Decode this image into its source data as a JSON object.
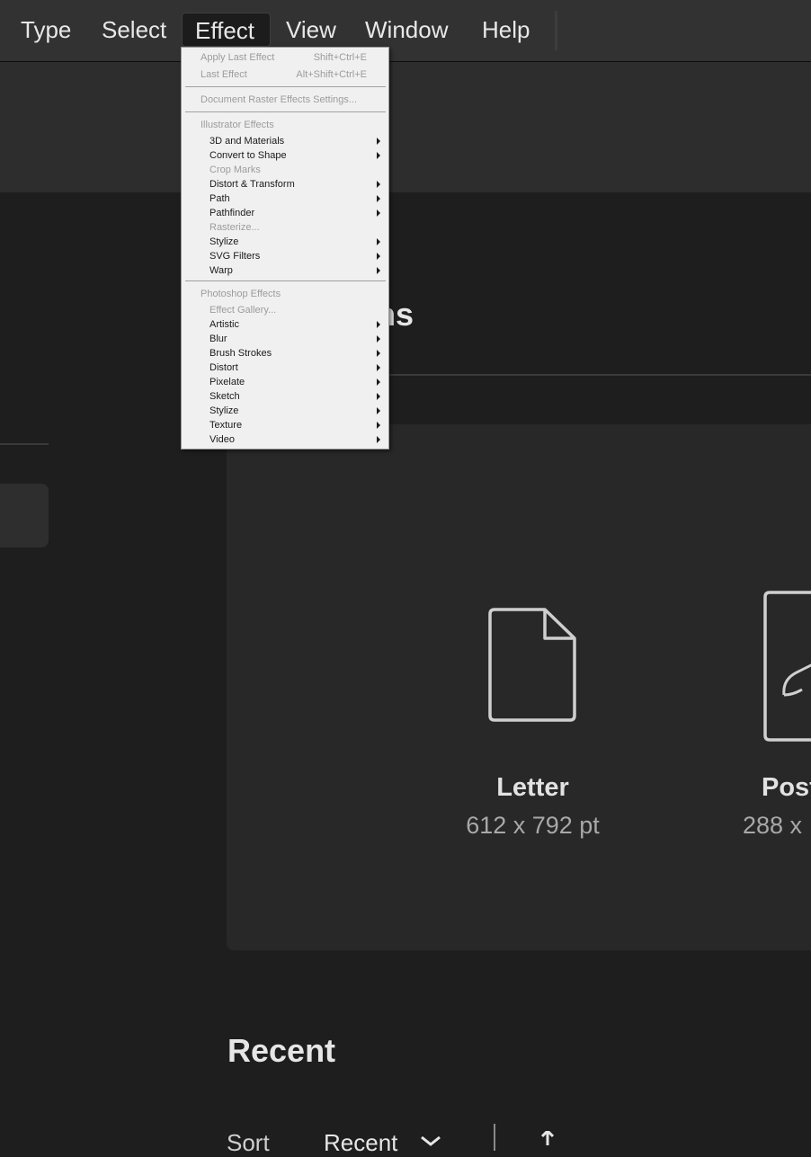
{
  "menubar": {
    "items": [
      {
        "label": "Type"
      },
      {
        "label": "Select"
      },
      {
        "label": "Effect"
      },
      {
        "label": "View"
      },
      {
        "label": "Window"
      },
      {
        "label": "Help"
      }
    ]
  },
  "effect_menu": {
    "apply_last_effect": {
      "label": "Apply Last Effect",
      "shortcut": "Shift+Ctrl+E"
    },
    "last_effect": {
      "label": "Last Effect",
      "shortcut": "Alt+Shift+Ctrl+E"
    },
    "document_raster_settings": "Document Raster Effects Settings...",
    "illustrator_header": "Illustrator Effects",
    "illustrator_items": [
      {
        "label": "3D and Materials"
      },
      {
        "label": "Convert to Shape"
      },
      {
        "label": "Crop Marks"
      },
      {
        "label": "Distort & Transform"
      },
      {
        "label": "Path"
      },
      {
        "label": "Pathfinder"
      },
      {
        "label": "Rasterize..."
      },
      {
        "label": "Stylize"
      },
      {
        "label": "SVG Filters"
      },
      {
        "label": "Warp"
      }
    ],
    "photoshop_header": "Photoshop Effects",
    "photoshop_items": [
      {
        "label": "Effect Gallery..."
      },
      {
        "label": "Artistic"
      },
      {
        "label": "Blur"
      },
      {
        "label": "Brush Strokes"
      },
      {
        "label": "Distort"
      },
      {
        "label": "Pixelate"
      },
      {
        "label": "Sketch"
      },
      {
        "label": "Stylize"
      },
      {
        "label": "Texture"
      },
      {
        "label": "Video"
      }
    ]
  },
  "presets": {
    "section_title_fragment": "ns",
    "items": [
      {
        "name": "Letter",
        "size": "612 x 792 pt"
      },
      {
        "name": "Post",
        "size": "288 x"
      }
    ]
  },
  "recent": {
    "title": "Recent",
    "sort_label": "Sort",
    "sort_value": "Recent"
  }
}
